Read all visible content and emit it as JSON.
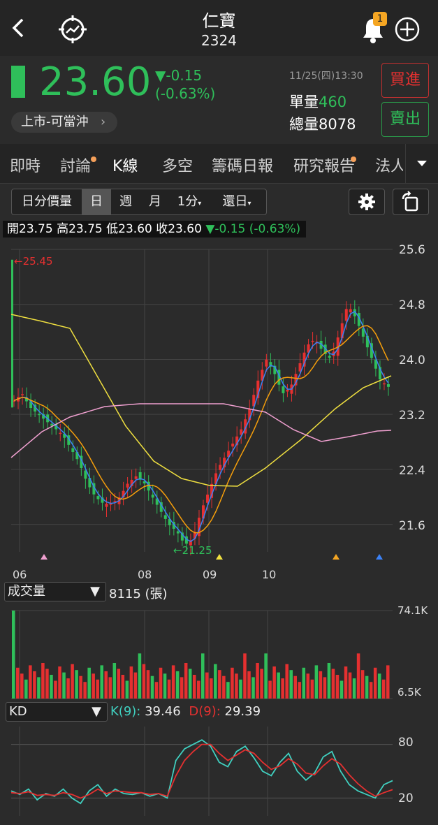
{
  "header": {
    "title": "仁寶",
    "code": "2324",
    "badge": "1"
  },
  "quote": {
    "price": "23.60",
    "change": "▼-0.15",
    "change_pct": "(-0.63%)",
    "datetime": "11/25(四)13:30",
    "market_label": "上市-可當沖",
    "unit_vol_label": "單量",
    "unit_vol": "460",
    "total_vol_label": "總量",
    "total_vol": "8078",
    "buy_label": "買進",
    "sell_label": "賣出"
  },
  "tabs": [
    "即時",
    "討論",
    "K線",
    "多空",
    "籌碼日報",
    "研究報告",
    "法人"
  ],
  "toolbar": {
    "minute_volume": "日分價量",
    "day": "日",
    "week": "週",
    "month": "月",
    "minute": "1分",
    "restore": "還日"
  },
  "ohlc": {
    "open_label": "開",
    "open": "23.75",
    "high_label": "高",
    "high": "23.75",
    "low_label": "低",
    "low": "23.60",
    "close_label": "收",
    "close": "23.60",
    "change": "▼-0.15 (-0.63%)"
  },
  "price_axis": [
    "25.6",
    "24.8",
    "24.0",
    "23.2",
    "22.4",
    "21.6"
  ],
  "date_axis": [
    "06",
    "08",
    "09",
    "10"
  ],
  "max_label": "←25.45",
  "min_label": "←21.25",
  "volume": {
    "selector": "成交量",
    "value": "8115 (張)",
    "max": "74.1K",
    "min": "6.5K"
  },
  "kd": {
    "selector": "KD",
    "k_label": "K(9):",
    "k_value": "39.46",
    "d_label": "D(9):",
    "d_value": "29.39",
    "axis": [
      "80",
      "20"
    ]
  },
  "colors": {
    "up": "#e53030",
    "down": "#2fbf5a",
    "ma5": "#3b82f6",
    "ma20": "#f59e0b",
    "ma60": "#f0e040",
    "ma240": "#f0a0d0",
    "k": "#40d0c0",
    "d": "#e53030"
  },
  "chart_data": {
    "type": "candlestick",
    "price_range": [
      21.2,
      25.6
    ],
    "close_series": [
      23.4,
      23.5,
      23.3,
      23.2,
      23.1,
      23.0,
      22.9,
      22.7,
      22.5,
      22.2,
      22.0,
      21.9,
      21.9,
      22.0,
      22.2,
      22.3,
      22.2,
      22.0,
      21.8,
      21.6,
      21.5,
      21.3,
      21.4,
      21.8,
      22.1,
      22.4,
      22.6,
      22.8,
      23.0,
      23.3,
      23.7,
      24.0,
      23.8,
      23.5,
      23.6,
      23.9,
      24.2,
      24.3,
      24.1,
      24.0,
      24.4,
      24.8,
      24.6,
      24.3,
      24.0,
      23.7,
      23.6
    ],
    "volume_range": [
      6.5,
      74.1
    ],
    "k_values": [
      28,
      24,
      30,
      18,
      25,
      22,
      30,
      20,
      14,
      28,
      35,
      22,
      30,
      25,
      24,
      26,
      22,
      25,
      20,
      62,
      75,
      80,
      85,
      78,
      60,
      55,
      72,
      78,
      65,
      50,
      45,
      60,
      70,
      50,
      40,
      48,
      66,
      72,
      50,
      35,
      28,
      24,
      20,
      35,
      39.46
    ],
    "d_values": [
      26,
      25,
      27,
      23,
      24,
      23,
      26,
      24,
      20,
      24,
      30,
      25,
      28,
      27,
      26,
      26,
      24,
      25,
      22,
      45,
      62,
      72,
      80,
      80,
      70,
      62,
      68,
      74,
      70,
      60,
      52,
      56,
      64,
      58,
      48,
      46,
      56,
      64,
      58,
      46,
      36,
      28,
      22,
      26,
      29.39
    ]
  }
}
